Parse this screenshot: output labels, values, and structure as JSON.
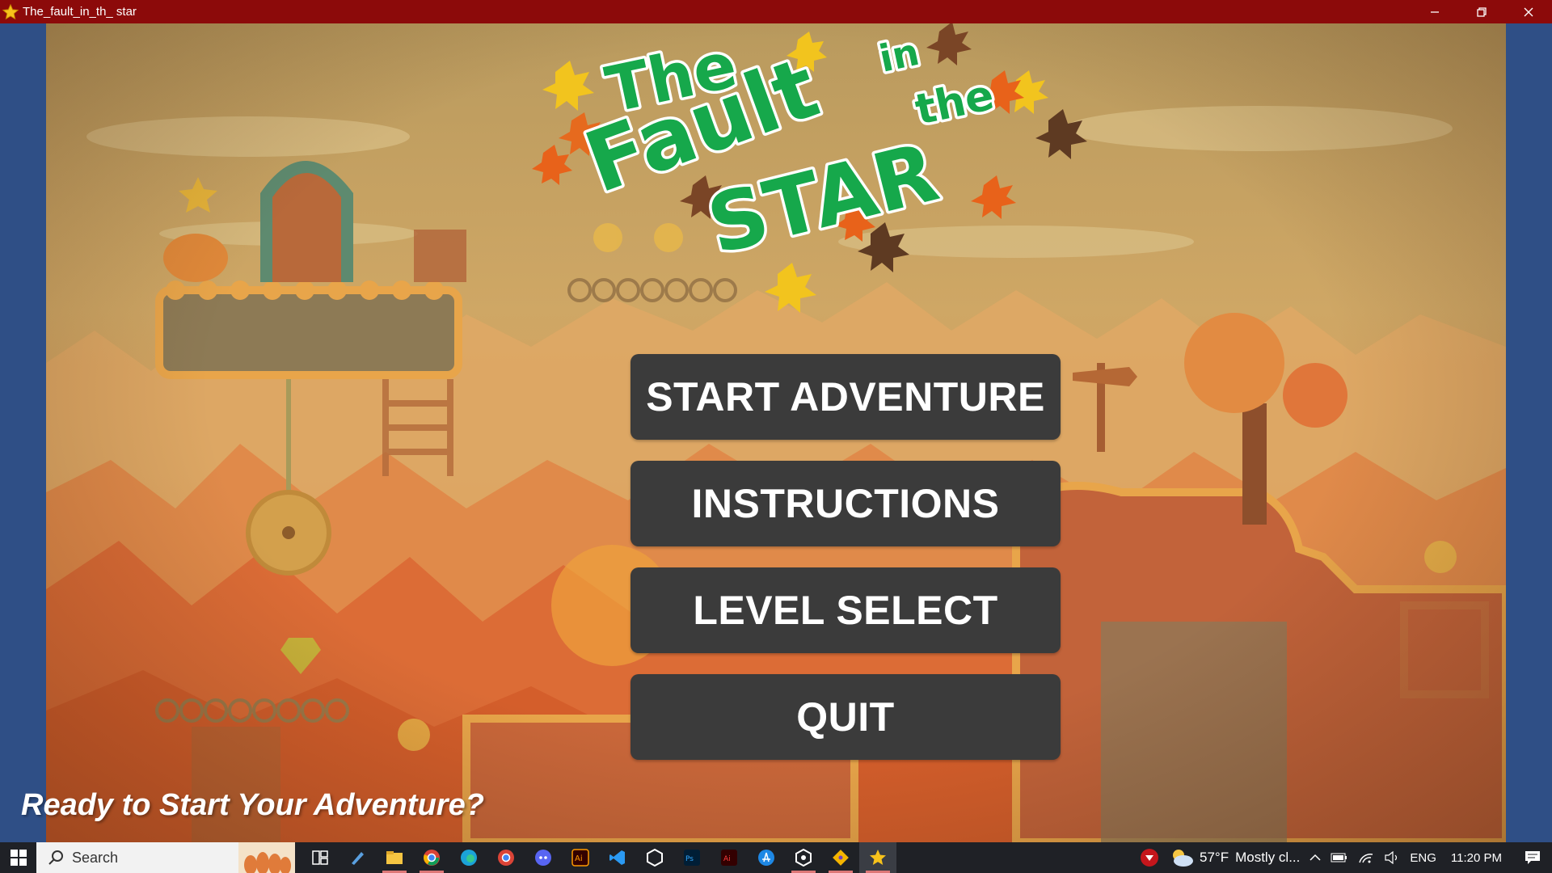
{
  "window": {
    "title": "The_fault_in_th_ star",
    "app_icon": "star-icon",
    "controls": [
      "minimize-icon",
      "restore-icon",
      "close-icon"
    ]
  },
  "logo": {
    "line1": "The",
    "line2": "in",
    "line3": "Fault",
    "line4": "the",
    "line5": "STAR"
  },
  "menu": {
    "start": "START ADVENTURE",
    "instructions": "INSTRUCTIONS",
    "level_select": "LEVEL SELECT",
    "quit": "QUIT"
  },
  "tagline": "Ready to Start Your Adventure?",
  "colors": {
    "titlebar": "#8c0a0a",
    "button_bg": "#3b3b3b",
    "logo_green": "#1aa84a",
    "sky": "#c9a766",
    "ground": "#d8672d"
  },
  "taskbar": {
    "search_placeholder": "Search",
    "apps": [
      "task-view-icon",
      "pen-app-icon",
      "file-explorer-icon",
      "chrome-icon",
      "edge-icon",
      "chrome-profile-icon",
      "discord-icon",
      "illustrator-icon",
      "vscode-icon",
      "unity-hub-icon",
      "photoshop-icon",
      "adobe-icon",
      "app-store-icon",
      "unity-icon",
      "git-icon",
      "game-star-icon"
    ],
    "weather_temp": "57°F",
    "weather_text": "Mostly cl...",
    "language": "ENG",
    "time": "11:20 PM"
  }
}
